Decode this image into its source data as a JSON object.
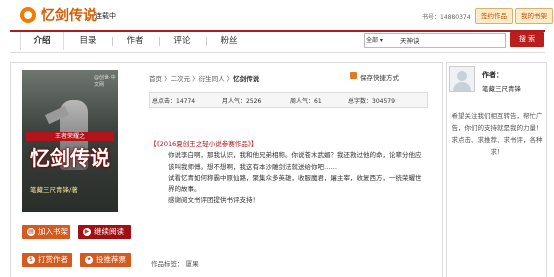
{
  "header": {
    "logo_text": "忆剑传说",
    "status": "连载中",
    "book_number": "书号：14880374",
    "btn_works": "签约作品",
    "btn_shelf": "我的书架"
  },
  "nav": {
    "tabs": [
      "介绍",
      "目录",
      "作者",
      "评论",
      "粉丝"
    ],
    "search_select": "全部 ▾",
    "search_value": "天神诀",
    "search_button": "搜 索"
  },
  "cover": {
    "banner": "王者荣耀之",
    "title": "忆剑传说",
    "author": "笔藏三尺青锋/著",
    "corner": "@创世·中文网"
  },
  "actions": {
    "add": "加入书架",
    "read": "继续阅读",
    "tip": "打赏作者",
    "vote": "投推荐票"
  },
  "breadcrumb": {
    "path": "首页 〉二次元 〉衍生同人 〉",
    "current": "忆剑传说"
  },
  "save_label": "保存快捷方式",
  "stats": {
    "total_clicks": "总点击：14774",
    "month_popularity": "月人气：2526",
    "week_popularity": "周人气：61",
    "word_count": "总字数：304579"
  },
  "description": {
    "highlight": "【《2016夏创王之轻小说参赛作品》】",
    "p1": "你说李白啊，那我认识，我和他兄弟相称。你说苍木武媚？我还救过他的命，论辈分他应该叫我师傅。想不想啊，我这有本沙雕剑法就送给你吧……",
    "p2": "试看忆青如何称霸中原仙路，聚集众多英雄，收服魔君，屠主宰，收复西方，一统荣耀世界的故事。",
    "p3": "感谢阅文书评团提供书评支持！"
  },
  "author_line": "作品标签：  厦果",
  "sidebar": {
    "label": "作者：",
    "name": "笔藏三尺青锋",
    "message": "希望关注我们相互转告，帮忙广告，你们的支持就是我的力量！求点击、求推荐、求书评，各种求！"
  },
  "colors": {
    "brand": "#d65c00",
    "nav_accent": "#ad1d1d",
    "button_orange": "#d55a1f",
    "button_red": "#a10f14"
  }
}
